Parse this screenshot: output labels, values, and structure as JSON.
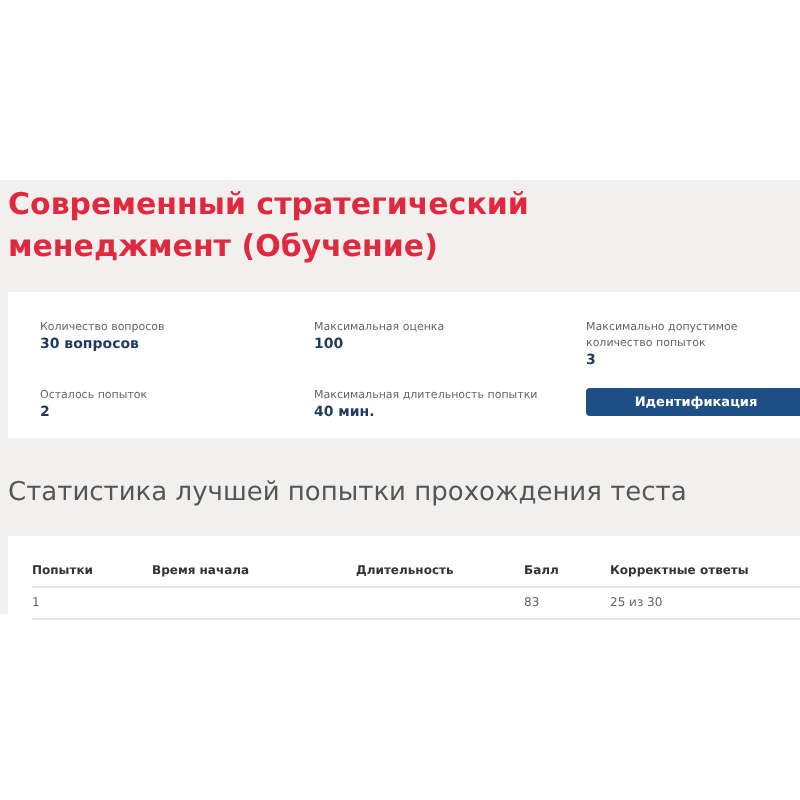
{
  "title": "Современный стратегический менеджмент (Обучение)",
  "info": [
    {
      "label": "Количество вопросов",
      "value": "30 вопросов"
    },
    {
      "label": "Максимальная оценка",
      "value": "100"
    },
    {
      "label": "Максимально допустимое количество попыток",
      "value": "3"
    },
    {
      "label": "Осталось попыток",
      "value": "2"
    },
    {
      "label": "Максимальная длительность попытки",
      "value": "40 мин."
    }
  ],
  "button": "Идентификация",
  "stats_title": "Статистика лучшей попытки прохождения теста",
  "table": {
    "columns": [
      "Попытки",
      "Время начала",
      "Длительность",
      "Балл",
      "Корректные ответы"
    ],
    "rows": [
      [
        "1",
        "",
        "",
        "83",
        "25 из 30"
      ]
    ]
  }
}
